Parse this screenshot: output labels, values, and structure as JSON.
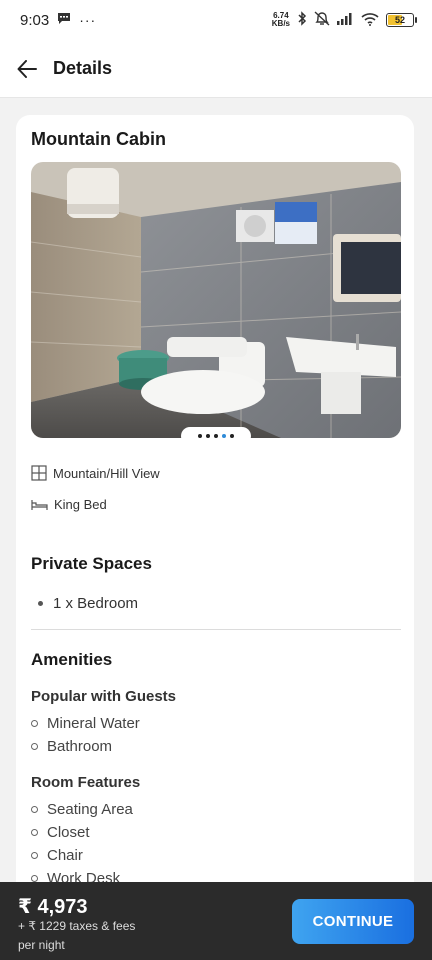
{
  "status_bar": {
    "time": "9:03",
    "net_speed_value": "6.74",
    "net_speed_unit": "KB/s",
    "battery": "52"
  },
  "header": {
    "title": "Details"
  },
  "room": {
    "title": "Mountain Cabin",
    "photo_count": 5,
    "active_photo_index": 3,
    "features": [
      {
        "icon": "window-icon",
        "label": "Mountain/Hill View"
      },
      {
        "icon": "bed-icon",
        "label": "King Bed"
      }
    ]
  },
  "private_spaces": {
    "title": "Private Spaces",
    "items": [
      "1 x Bedroom"
    ]
  },
  "amenities": {
    "title": "Amenities",
    "groups": [
      {
        "title": "Popular with Guests",
        "items": [
          "Mineral Water",
          "Bathroom"
        ]
      },
      {
        "title": "Room Features",
        "items": [
          "Seating Area",
          "Closet",
          "Chair",
          "Work Desk"
        ]
      }
    ]
  },
  "booking": {
    "price": "₹ 4,973",
    "taxes": "+ ₹ 1229 taxes & fees",
    "per_night": "per night",
    "continue_label": "CONTINUE"
  },
  "colors": {
    "accent": "#1a6fe0",
    "bottom_bar": "#2b2b2b",
    "battery_fill": "#f2c230"
  }
}
